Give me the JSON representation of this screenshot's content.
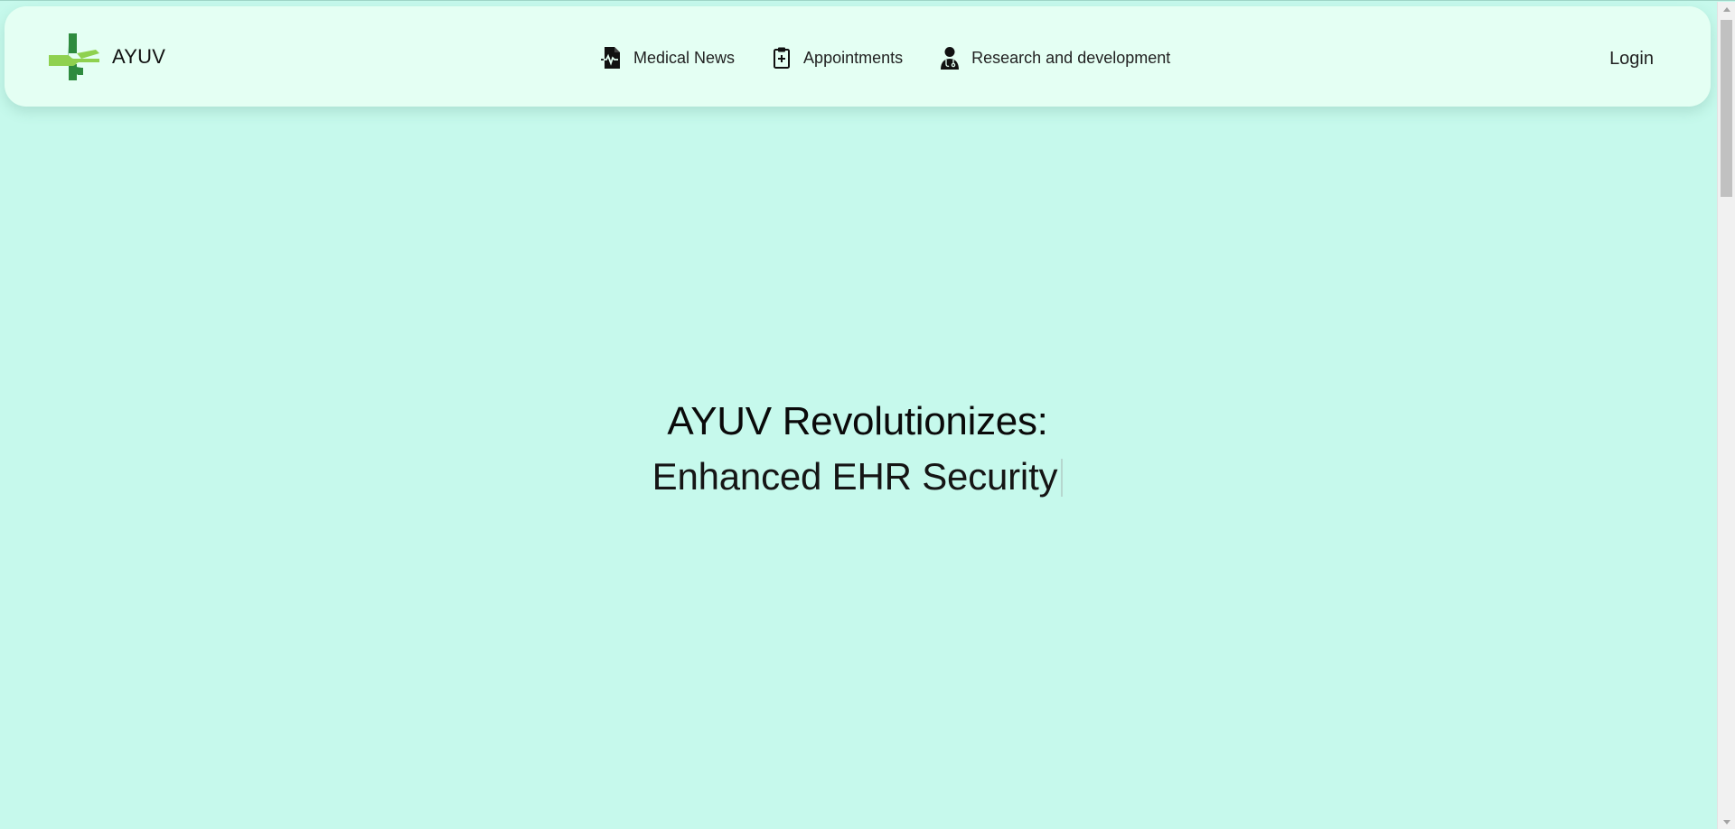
{
  "brand": {
    "name": "AYUV",
    "logo_colors": [
      "#8fd14f",
      "#2e8b3e"
    ]
  },
  "nav": {
    "items": [
      {
        "label": "Medical News",
        "icon": "medical-news-file-icon"
      },
      {
        "label": "Appointments",
        "icon": "clipboard-plus-icon"
      },
      {
        "label": "Research and development",
        "icon": "doctor-icon"
      }
    ]
  },
  "login": {
    "label": "Login"
  },
  "hero": {
    "title": "AYUV Revolutionizes:",
    "subtitle": "Enhanced EHR Security"
  },
  "colors": {
    "background": "#c6f9ec",
    "navbar": "#e4fff3"
  }
}
